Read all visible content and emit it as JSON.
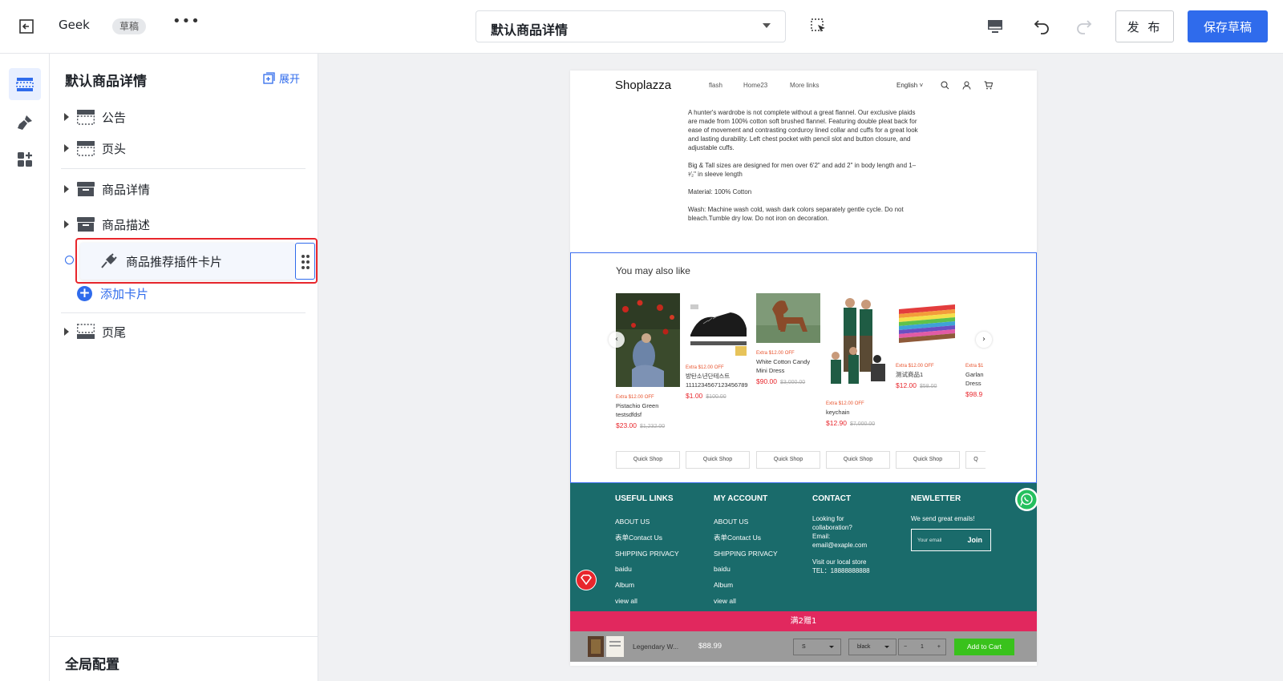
{
  "topbar": {
    "store_name": "Geek",
    "draft_badge": "草稿",
    "more": "•••",
    "template_select": "默认商品详情",
    "publish_label": "发 布",
    "save_draft_label": "保存草稿"
  },
  "panel": {
    "title": "默认商品详情",
    "expand_label": "展开",
    "items": [
      {
        "label": "公告",
        "icon": "layout-announcement-icon"
      },
      {
        "label": "页头",
        "icon": "layout-header-icon"
      },
      {
        "label": "商品详情",
        "icon": "product-box-icon"
      },
      {
        "label": "商品描述",
        "icon": "product-box-icon"
      }
    ],
    "selected_card": "商品推荐插件卡片",
    "add_card": "添加卡片",
    "footer_item": "页尾",
    "global_config": "全局配置"
  },
  "preview": {
    "logo": "Shoplazza",
    "nav": [
      "flash",
      "Home23",
      "More links"
    ],
    "language": "English",
    "description": [
      "A hunter's wardrobe is not complete without a great flannel. Our exclusive plaids are made from 100% cotton soft brushed flannel. Featuring double pleat back for ease of movement and contrasting corduroy lined collar and cuffs for a great look and lasting durability. Left chest pocket with pencil slot and button closure, and adjustable cuffs.",
      "Big & Tall sizes are designed for men over 6'2\" and add 2\" in body length and 1–¹⁄₂\" in sleeve length",
      "Material: 100% Cotton",
      "Wash: Machine wash cold, wash dark colors separately gentle cycle. Do not bleach.Tumble dry low. Do not iron on decoration."
    ],
    "recommend_title": "You may also like",
    "products": [
      {
        "off": "Extra $12.00 OFF",
        "name": "Pistachio Green testsdfdsf",
        "price": "$23.00",
        "orig": "$1,232.00"
      },
      {
        "off": "Extra $12.00 OFF",
        "name": "방탄소년단테스트 1111234567123456789",
        "price": "$1.00",
        "orig": "$100.00"
      },
      {
        "off": "Extra $12.00 OFF",
        "name": "White Cotton Candy Mini Dress",
        "price": "$90.00",
        "orig": "$3,000.00"
      },
      {
        "off": "Extra $12.00 OFF",
        "name": "keychain",
        "price": "$12.90",
        "orig": "$7,000.00"
      },
      {
        "off": "Extra $12.00 OFF",
        "name": "测试商品1",
        "price": "$12.00",
        "orig": "$58.00"
      },
      {
        "off": "Extra $1",
        "name": "Garlan Dress",
        "price": "$98.9",
        "orig": ""
      }
    ],
    "quick_shop": "Quick Shop",
    "quick_shop_partial": "Q",
    "footer": {
      "useful_links": {
        "title": "USEFUL LINKS",
        "links": [
          "ABOUT US",
          "表单Contact Us",
          "SHIPPING PRIVACY",
          "baidu",
          "Album",
          "view all"
        ]
      },
      "my_account": {
        "title": "MY ACCOUNT",
        "links": [
          "ABOUT US",
          "表单Contact Us",
          "SHIPPING PRIVACY",
          "baidu",
          "Album",
          "view all"
        ]
      },
      "contact": {
        "title": "CONTACT",
        "line1": "Looking for collaboration?",
        "email_label": "Email:",
        "email": "email@exaple.com",
        "visit": "Visit our local store",
        "tel": "TEL：18888888888"
      },
      "newsletter": {
        "title": "NEWLETTER",
        "text": "We send great emails!",
        "placeholder": "Your email",
        "join": "Join"
      }
    },
    "promo": "满2赠1",
    "sticky_bar": {
      "name": "Legendary W...",
      "price": "$88.99",
      "size": "S",
      "color": "black",
      "qty_minus": "−",
      "qty": "1",
      "qty_plus": "+",
      "add_to_cart": "Add to Cart"
    }
  },
  "colors": {
    "accent": "#2f6bec",
    "selection_red": "#e8262c",
    "footer_teal": "#1a6b6b",
    "promo_pink": "#e1285e",
    "add_cart_green": "#39c21c"
  }
}
